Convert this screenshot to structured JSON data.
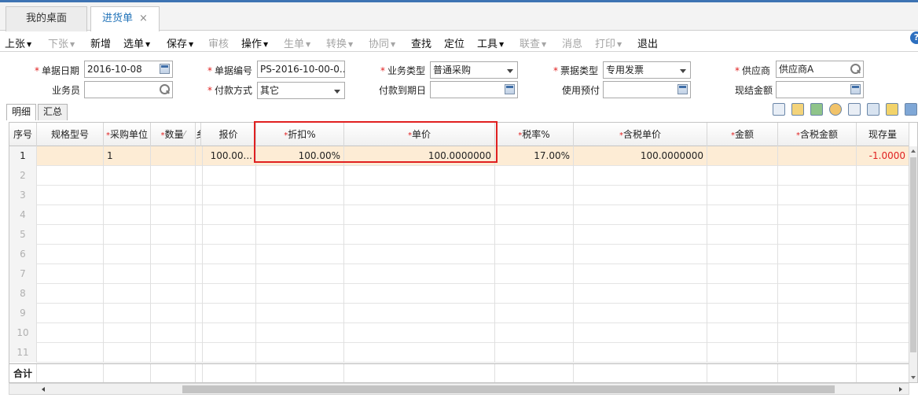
{
  "tabs": {
    "home_label": "我的桌面",
    "active_label": "进货单",
    "close_glyph": "×"
  },
  "toolbar": {
    "prev": "上张",
    "next": "下张",
    "new": "新增",
    "select": "选单",
    "save": "保存",
    "audit": "审核",
    "ops": "操作",
    "gen": "生单",
    "convert": "转换",
    "collab": "协同",
    "find": "查找",
    "locate": "定位",
    "tools": "工具",
    "link": "联查",
    "cancel": "消息",
    "print": "打印",
    "exit": "退出",
    "help": "?"
  },
  "form": {
    "date_label": "单据日期",
    "date_value": "2016-10-08",
    "code_label": "单据编号",
    "code_value": "PS-2016-10-00-0...",
    "biztype_label": "业务类型",
    "biztype_value": "普通采购",
    "invtype_label": "票据类型",
    "invtype_value": "专用发票",
    "vendor_label": "供应商",
    "vendor_value": "供应商A",
    "clerk_label": "业务员",
    "clerk_value": "",
    "pay_label": "付款方式",
    "pay_value": "其它",
    "due_label": "付款到期日",
    "due_value": "",
    "prepay_label": "使用预付",
    "prepay_value": "",
    "cash_label": "现结金额",
    "cash_value": ""
  },
  "subtabs": {
    "detail": "明细",
    "summary": "汇总"
  },
  "grid": {
    "headers": {
      "idx": "序号",
      "spec": "规格型号",
      "unit": "采购单位",
      "qty": "数量",
      "narrow": "乡",
      "price": "报价",
      "discount": "折扣%",
      "unitprice": "单价",
      "tax": "税率%",
      "taxprice": "含税单价",
      "amount": "金额",
      "taxamount": "含税金额",
      "stock": "现存量"
    },
    "row1": {
      "idx": "1",
      "spec": "",
      "unit": "1",
      "qty": "",
      "price": "100.00...",
      "discount": "100.00%",
      "unitprice": "100.0000000",
      "tax": "17.00%",
      "taxprice": "100.0000000",
      "amount": "",
      "taxamount": "",
      "stock": "-1.0000"
    },
    "row_numbers": [
      "2",
      "3",
      "4",
      "5",
      "6",
      "7",
      "8",
      "9",
      "10",
      "11"
    ],
    "total_label": "合计"
  },
  "colors": {
    "accent": "#1f72b8",
    "required": "#e02020",
    "selected_row": "#fdecd5",
    "highlight_box": "#e02020"
  }
}
